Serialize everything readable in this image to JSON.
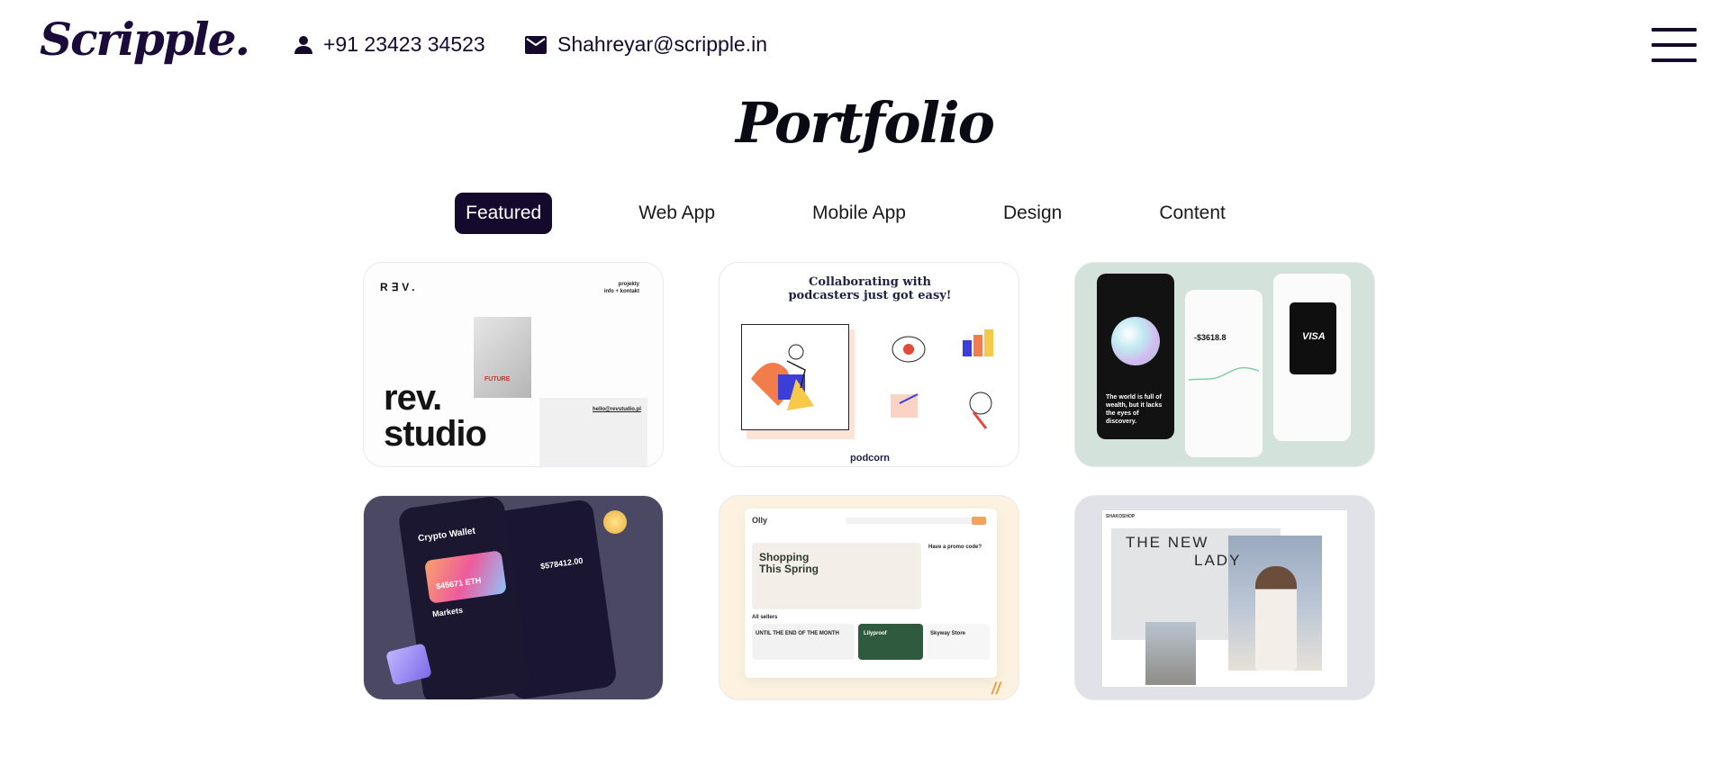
{
  "header": {
    "logo": "Scripple.",
    "phone": "+91 23423 34523",
    "email": "Shahreyar@scripple.in"
  },
  "page": {
    "title": "Portfolio"
  },
  "tabs": [
    {
      "label": "Featured",
      "active": true
    },
    {
      "label": "Web App",
      "active": false
    },
    {
      "label": "Mobile App",
      "active": false
    },
    {
      "label": "Design",
      "active": false
    },
    {
      "label": "Content",
      "active": false
    }
  ],
  "cards": [
    {
      "name": "rev-studio",
      "logo": "R∃V.",
      "projects": "projekty",
      "contact_line": "info + kontakt",
      "paper_text": "FUTURE",
      "email": "hello@revstudio.pl",
      "headline_1": "rev.",
      "headline_2": "studio"
    },
    {
      "name": "podcorn",
      "headline": "Collaborating with podcasters just got easy!",
      "brand": "podcorn"
    },
    {
      "name": "fintech-app",
      "tagline": "The world is full of wealth, but it lacks the eyes of discovery.",
      "amount": "-$3618.8",
      "card_brand": "VISA"
    },
    {
      "name": "crypto-wallet",
      "title": "Crypto Wallet",
      "balance": "$45671 ETH",
      "section": "Markets",
      "value": "$578412.00"
    },
    {
      "name": "olly-shop",
      "logo": "Olly",
      "hero": "Shopping This Spring",
      "promo": "Have a promo code?",
      "section": "All sellers",
      "banner_1": "UNTIL THE END OF THE MONTH",
      "banner_2": "Lilyproof",
      "banner_3": "Skyway Store"
    },
    {
      "name": "fashion-store",
      "shop": "SHAKOSHOP",
      "title_1": "THE NEW",
      "title_2": "LADY"
    }
  ],
  "colors": {
    "brand": "#150a2e",
    "tab_active_bg": "#150a2e",
    "tab_active_text": "#ffffff"
  },
  "icons": {
    "phone": "person-icon",
    "email": "mail-icon",
    "menu": "hamburger-icon"
  }
}
